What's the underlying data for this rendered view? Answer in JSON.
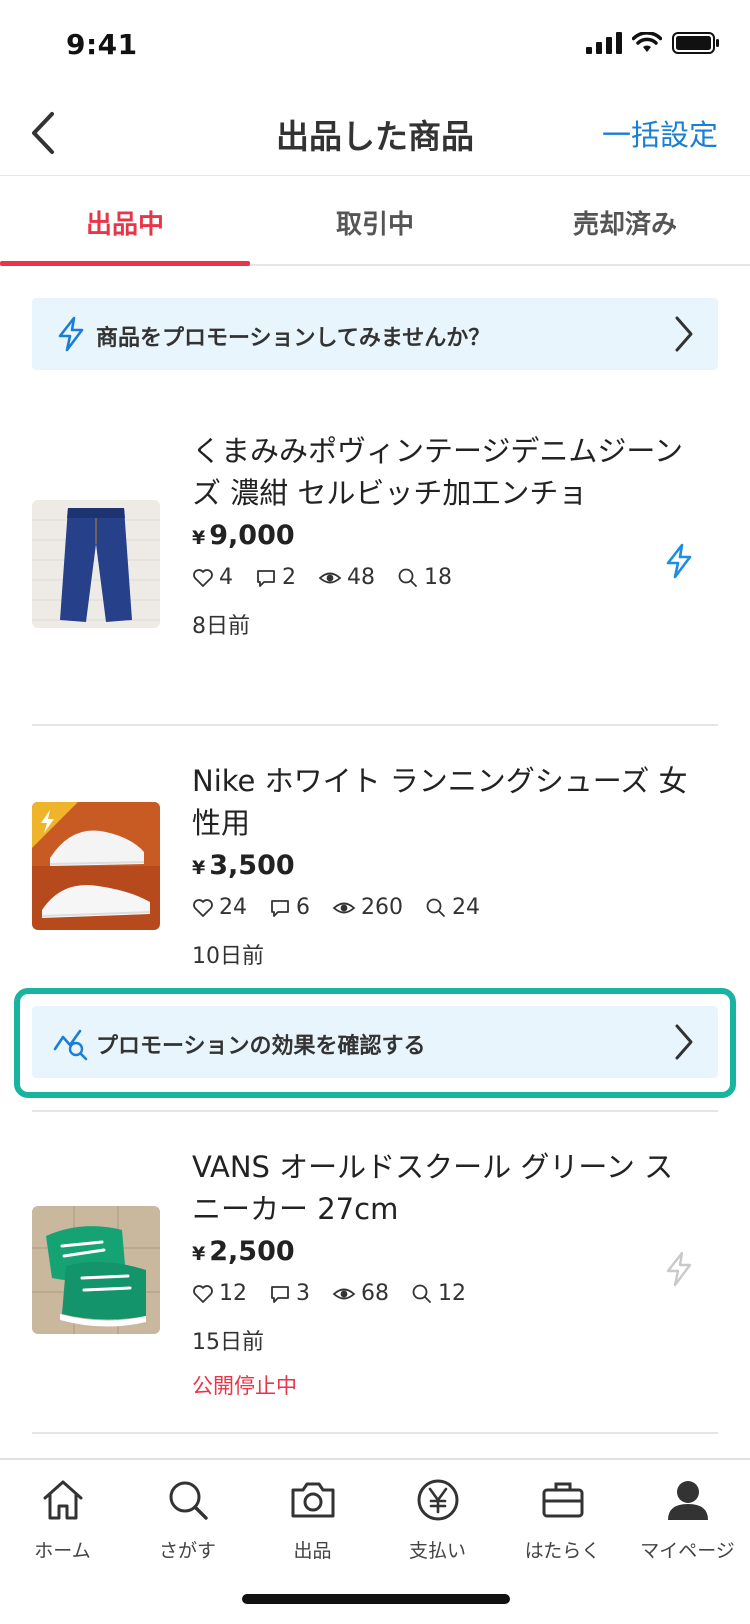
{
  "status_bar": {
    "time": "9:41"
  },
  "nav": {
    "title": "出品した商品",
    "action": "一括設定"
  },
  "tabs": [
    {
      "label": "出品中",
      "active": true
    },
    {
      "label": "取引中",
      "active": false
    },
    {
      "label": "売却済み",
      "active": false
    }
  ],
  "promo_banner": {
    "text": "商品をプロモーションしてみませんか？",
    "icon": "bolt-icon"
  },
  "items": [
    {
      "title": "くまみみポヴィンテージデニムジーンズ 濃紺 セルビッチ加工ンチョ",
      "currency": "¥",
      "price": "9,000",
      "likes": "4",
      "comments": "2",
      "views": "48",
      "searches": "18",
      "age": "8日前",
      "status": "",
      "promoted": false,
      "bolt_active": true
    },
    {
      "title": "Nike ホワイト ランニングシューズ 女性用",
      "currency": "¥",
      "price": "3,500",
      "likes": "24",
      "comments": "6",
      "views": "260",
      "searches": "24",
      "age": "10日前",
      "status": "",
      "promoted": true,
      "bolt_active": false
    },
    {
      "title": "VANS オールドスクール グリーン スニーカー 27cm",
      "currency": "¥",
      "price": "2,500",
      "likes": "12",
      "comments": "3",
      "views": "68",
      "searches": "12",
      "age": "15日前",
      "status": "公開停止中",
      "promoted": false,
      "bolt_active": false
    }
  ],
  "promo_effect_banner": {
    "text": "プロモーションの効果を確認する",
    "icon": "analytics-icon"
  },
  "tabbar": [
    {
      "label": "ホーム",
      "icon": "home-icon"
    },
    {
      "label": "さがす",
      "icon": "search-icon"
    },
    {
      "label": "出品",
      "icon": "camera-icon"
    },
    {
      "label": "支払い",
      "icon": "yen-icon"
    },
    {
      "label": "はたらく",
      "icon": "briefcase-icon"
    },
    {
      "label": "マイページ",
      "icon": "user-icon"
    }
  ],
  "colors": {
    "accent_red": "#ea3548",
    "link_blue": "#1a7fd4",
    "banner_bg": "#e8f5fd",
    "highlight_teal": "#19b4a0"
  }
}
